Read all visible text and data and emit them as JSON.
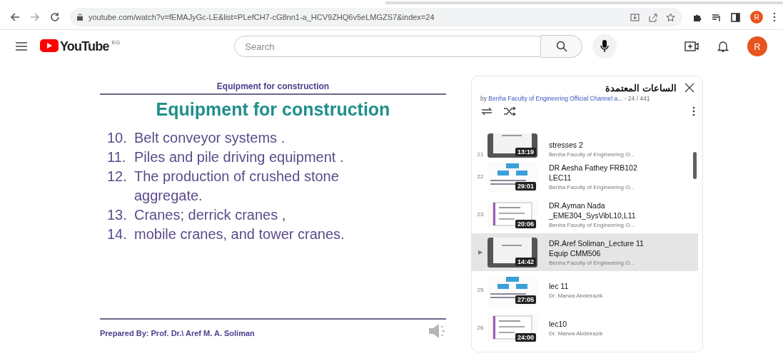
{
  "browser": {
    "url": "youtube.com/watch?v=fEMAJyGc-LE&list=PLefCH7-cG8nn1-a_HCV9ZHQ6v5eLMGZS7&index=24",
    "profile_initial": "R"
  },
  "header": {
    "logo": "YouTube",
    "country": "EG",
    "search_placeholder": "Search",
    "avatar_initial": "R"
  },
  "slide": {
    "header": "Equipment for construction",
    "title": "Equipment for construction",
    "items": [
      {
        "number": "10.",
        "text": "Belt conveyor systems ."
      },
      {
        "number": "11.",
        "text": "Piles and pile driving equipment ."
      },
      {
        "number": "12.",
        "text": "The production of crushed stone aggregate."
      },
      {
        "number": "13.",
        "text": "Cranes; derrick cranes ,"
      },
      {
        "number": "14.",
        "text": "mobile cranes, and tower cranes."
      }
    ],
    "footer": "Prepared By: Prof. Dr.\\ Aref M. A. Soliman"
  },
  "playlist": {
    "title": "الساعات المعتمدة",
    "owner_prefix": "by",
    "owner": "Benha Faculty of Engineering Official Channel a...",
    "position": "- 24 / 441",
    "videos": [
      {
        "index": "21",
        "title": "stresses 2",
        "channel": "Benha Faculty of Engineering O...",
        "duration": "13:19",
        "selected": false
      },
      {
        "index": "22",
        "title": "DR Aesha Fathey FRB102 LEC11",
        "channel": "Benha Faculty of Engineering O...",
        "duration": "29:01",
        "selected": false
      },
      {
        "index": "23",
        "title": "DR.Ayman Nada _EME304_SysVibL10,L11",
        "channel": "Benha Faculty of Engineering O...",
        "duration": "20:06",
        "selected": false
      },
      {
        "index": "▶",
        "title": "DR.Aref Soliman_Lecture 11 Equip CMM506",
        "channel": "Benha Faculty of Engineering O...",
        "duration": "14:42",
        "selected": true
      },
      {
        "index": "25",
        "title": "lec 11",
        "channel": "Dr. Marwa Abdelrazik",
        "duration": "27:05",
        "selected": false
      },
      {
        "index": "26",
        "title": "lec10",
        "channel": "Dr. Marwa Abdelrazik",
        "duration": "24:00",
        "selected": false
      }
    ]
  }
}
